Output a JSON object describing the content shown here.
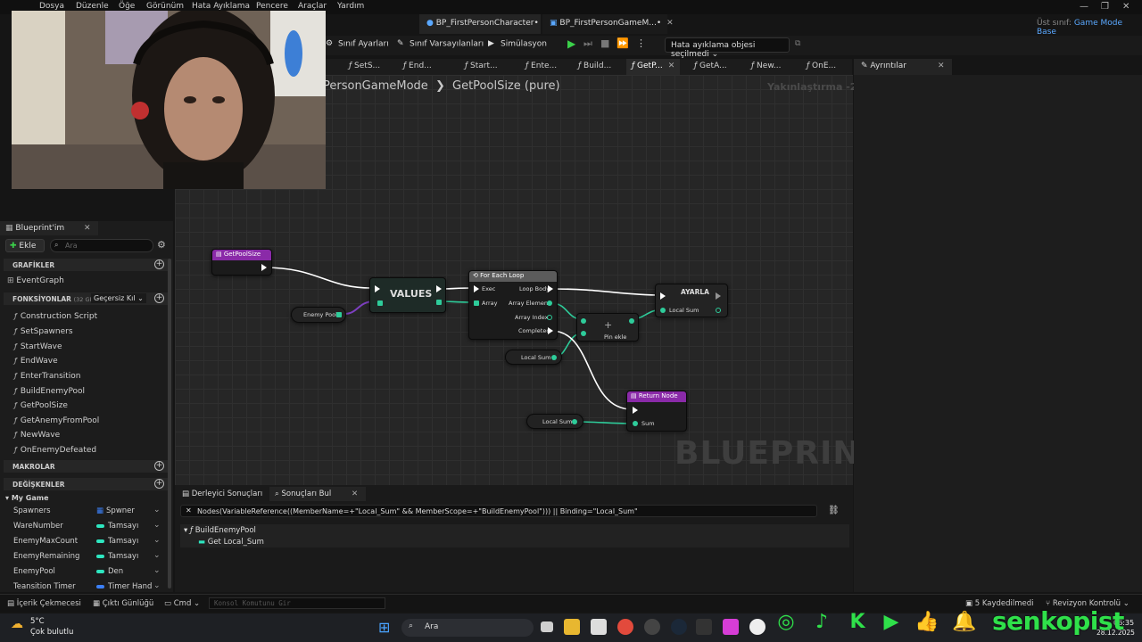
{
  "menu": [
    "Dosya",
    "Düzenle",
    "Öğe",
    "Görünüm",
    "Hata Ayıklama",
    "Pencere",
    "Araçlar",
    "Yardım"
  ],
  "doc_tabs": [
    "BP_FirstPersonCharacter•",
    "BP_FirstPersonGameM...•"
  ],
  "parent_class": {
    "label": "Üst sınıf:",
    "value": "Game Mode Base"
  },
  "toolbar": {
    "class_settings": "Sınıf Ayarları",
    "class_defaults": "Sınıf Varsayılanları",
    "simulation": "Simülasyon",
    "debug_object": "Hata ayıklama objesi seçilmedi"
  },
  "graph_tabs": [
    "SetS...",
    "End...",
    "Start...",
    "Ente...",
    "Build...",
    "GetP...",
    "GetA...",
    "New...",
    "OnE..."
  ],
  "details_tab": "Ayrıntılar",
  "breadcrumb": {
    "parent": "PersonGameMode",
    "current": "GetPoolSize (pure)"
  },
  "zoom": "Yakınlaştırma -2",
  "watermark": "BLUEPRINT",
  "nodes": {
    "entry": "GetPoolSize",
    "enemy_pool": "Enemy Pool",
    "values": "VALUES",
    "foreach": {
      "title": "For Each Loop",
      "exec": "Exec",
      "array": "Array",
      "loop_body": "Loop Body",
      "element": "Array Element",
      "index": "Array Index",
      "completed": "Completed"
    },
    "set": {
      "title": "AYARLA",
      "local_sum": "Local Sum"
    },
    "add": {
      "label": "Pin ekle",
      "plus": "+"
    },
    "local_sum_get1": "Local Sum",
    "return": {
      "title": "Return Node",
      "sum": "Sum"
    },
    "local_sum_get2": "Local Sum"
  },
  "left_panel": {
    "tab": "Blueprint'im",
    "add": "Ekle",
    "search_placeholder": "Ara",
    "graphs_header": "GRAFİKLER",
    "event_graph": "EventGraph",
    "functions_header": "FONKSİYONLAR",
    "functions_count": "(32 GEÇE",
    "override": "Geçersiz Kıl",
    "functions": [
      "Construction Script",
      "SetSpawners",
      "StartWave",
      "EndWave",
      "EnterTransition",
      "BuildEnemyPool",
      "GetPoolSize",
      "GetAnemyFromPool",
      "NewWave",
      "OnEnemyDefeated"
    ],
    "macros_header": "MAKROLAR",
    "variables_header": "DEĞİŞKENLER",
    "category": "My Game",
    "variables": [
      {
        "name": "Spawners",
        "type": "Spwner",
        "color": "#3b7ff5"
      },
      {
        "name": "WareNumber",
        "type": "Tamsayı",
        "color": "#2ee6c0"
      },
      {
        "name": "EnemyMaxCount",
        "type": "Tamsayı",
        "color": "#2ee6c0"
      },
      {
        "name": "EnemyRemaining",
        "type": "Tamsayı",
        "color": "#2ee6c0"
      },
      {
        "name": "EnemyPool",
        "type": "Den",
        "color": "#2ee6c0"
      },
      {
        "name": "Teansition Timer",
        "type": "Timer Hand",
        "color": "#3b7ff5"
      }
    ]
  },
  "results": {
    "tab1": "Derleyici Sonuçları",
    "tab2": "Sonuçları Bul",
    "query": "Nodes(VariableReference((MemberName=+\"Local_Sum\" && MemberScope=+\"BuildEnemyPool\"))) || Binding=\"Local_Sum\"",
    "tree_parent": "BuildEnemyPool",
    "tree_child": "Get Local_Sum"
  },
  "status": {
    "content_drawer": "İçerik Çekmecesi",
    "output_log": "Çıktı Günlüğü",
    "cmd": "Cmd",
    "console_placeholder": "Konsol Komutunu Gir",
    "saved": "5 Kaydedilmedi",
    "revision": "Revizyon Kontrolü"
  },
  "taskbar": {
    "temp": "5°C",
    "weather": "Çok bulutlu",
    "search": "Ara",
    "time": "06:35",
    "date": "28.12.2025"
  },
  "brand": "senkopist"
}
